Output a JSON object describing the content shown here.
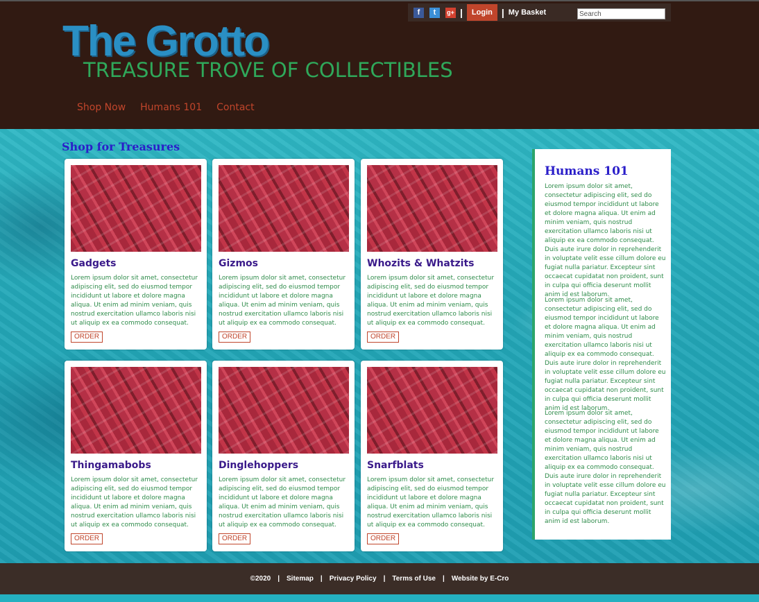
{
  "topbar": {
    "social": [
      "facebook-icon",
      "twitter-icon",
      "google-plus-icon"
    ],
    "login_label": "Login",
    "basket_label": "My Basket",
    "search_placeholder": "Search"
  },
  "brand": {
    "title": "The Grotto",
    "tagline": "TREASURE TROVE OF COLLECTIBLES"
  },
  "nav": [
    "Shop Now",
    "Humans 101",
    "Contact"
  ],
  "section_title": "Shop for Treasures",
  "products": [
    {
      "name": "Gadgets",
      "desc": "Lorem ipsum dolor sit amet, consectetur adipiscing elit, sed do eiusmod tempor incididunt ut labore et dolore magna aliqua. Ut enim ad minim veniam, quis nostrud exercitation ullamco laboris nisi ut aliquip ex ea commodo consequat.",
      "button": "ORDER"
    },
    {
      "name": "Gizmos",
      "desc": "Lorem ipsum dolor sit amet, consectetur adipiscing elit, sed do eiusmod tempor incididunt ut labore et dolore magna aliqua. Ut enim ad minim veniam, quis nostrud exercitation ullamco laboris nisi ut aliquip ex ea commodo consequat.",
      "button": "ORDER"
    },
    {
      "name": "Whozits & Whatzits",
      "desc": "Lorem ipsum dolor sit amet, consectetur adipiscing elit, sed do eiusmod tempor incididunt ut labore et dolore magna aliqua. Ut enim ad minim veniam, quis nostrud exercitation ullamco laboris nisi ut aliquip ex ea commodo consequat.",
      "button": "ORDER"
    },
    {
      "name": "Thingamabobs",
      "desc": "Lorem ipsum dolor sit amet, consectetur adipiscing elit, sed do eiusmod tempor incididunt ut labore et dolore magna aliqua. Ut enim ad minim veniam, quis nostrud exercitation ullamco laboris nisi ut aliquip ex ea commodo consequat.",
      "button": "ORDER"
    },
    {
      "name": "Dinglehoppers",
      "desc": "Lorem ipsum dolor sit amet, consectetur adipiscing elit, sed do eiusmod tempor incididunt ut labore et dolore magna aliqua. Ut enim ad minim veniam, quis nostrud exercitation ullamco laboris nisi ut aliquip ex ea commodo consequat.",
      "button": "ORDER"
    },
    {
      "name": "Snarfblats",
      "desc": "Lorem ipsum dolor sit amet, consectetur adipiscing elit, sed do eiusmod tempor incididunt ut labore et dolore magna aliqua. Ut enim ad minim veniam, quis nostrud exercitation ullamco laboris nisi ut aliquip ex ea commodo consequat.",
      "button": "ORDER"
    }
  ],
  "sidebar": {
    "title": "Humans 101",
    "paragraphs": [
      "Lorem ipsum dolor sit amet, consectetur adipiscing elit, sed do eiusmod tempor incididunt ut labore et dolore magna aliqua. Ut enim ad minim veniam, quis nostrud exercitation ullamco laboris nisi ut aliquip ex ea commodo consequat. Duis aute irure dolor in reprehenderit in voluptate velit esse cillum dolore eu fugiat nulla pariatur. Excepteur sint occaecat cupidatat non proident, sunt in culpa qui officia deserunt mollit anim id est laborum.",
      "Lorem ipsum dolor sit amet, consectetur adipiscing elit, sed do eiusmod tempor incididunt ut labore et dolore magna aliqua. Ut enim ad minim veniam, quis nostrud exercitation ullamco laboris nisi ut aliquip ex ea commodo consequat. Duis aute irure dolor in reprehenderit in voluptate velit esse cillum dolore eu fugiat nulla pariatur. Excepteur sint occaecat cupidatat non proident, sunt in culpa qui officia deserunt mollit anim id est laborum.",
      "Lorem ipsum dolor sit amet, consectetur adipiscing elit, sed do eiusmod tempor incididunt ut labore et dolore magna aliqua. Ut enim ad minim veniam, quis nostrud exercitation ullamco laboris nisi ut aliquip ex ea commodo consequat. Duis aute irure dolor in reprehenderit in voluptate velit esse cillum dolore eu fugiat nulla pariatur. Excepteur sint occaecat cupidatat non proident, sunt in culpa qui officia deserunt mollit anim id est laborum."
    ]
  },
  "footer": {
    "copyright": "©2020",
    "links": [
      "Sitemap",
      "Privacy Policy",
      "Terms of Use",
      "Website by E-Cro"
    ]
  },
  "colors": {
    "header_bg": "#311a12",
    "accent": "#c0452b",
    "heading_blue": "#2a1ec9",
    "body_green": "#2e8b4a",
    "product_title": "#3a1a8a"
  }
}
